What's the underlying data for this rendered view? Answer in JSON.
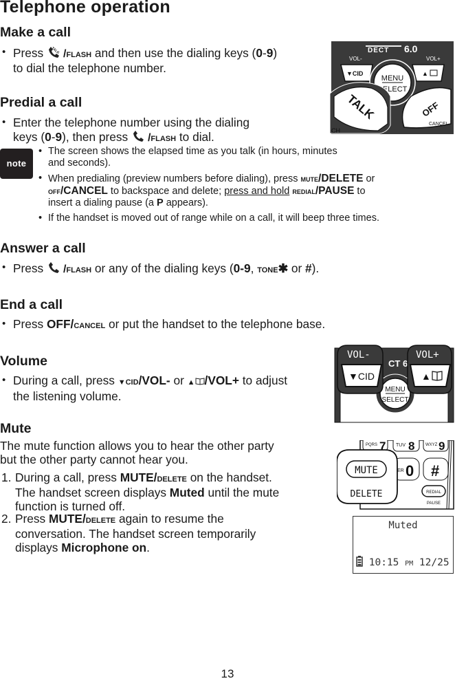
{
  "page": {
    "title": "Telephone operation",
    "page_number": "13"
  },
  "sections": {
    "make_call": {
      "heading": "Make a call",
      "b1_pre": "Press ",
      "b1_key": "/FLASH",
      "b1_mid": " and then use the dialing keys (",
      "b1_keys": "0",
      "b1_dash": "-",
      "b1_keys2": "9",
      "b1_post1": ")",
      "b1_line2": "to dial the telephone number."
    },
    "predial": {
      "heading": "Predial a call",
      "line1": "Enter the telephone number using the dialing",
      "l2_pre": "keys (",
      "l2_k1": "0",
      "l2_dash": "-",
      "l2_k2": "9",
      "l2_mid": "), then press ",
      "l2_key": "/FLASH",
      "l2_post": " to dial."
    },
    "note": {
      "label": "note",
      "items": [
        {
          "line1": "The screen shows the elapsed time as you talk (in hours, minutes",
          "line2": "and seconds)."
        },
        {
          "p1": "When predialing (preview numbers before dialing), press ",
          "k1": "MUTE",
          "k1b": "/DELETE",
          "p2": " or ",
          "k2": "OFF",
          "k2b": "/CANCEL",
          "p3": " to backspace and delete; ",
          "u": "press and hold",
          "p4": " ",
          "k3": "REDIAL",
          "k3b": "/PAUSE",
          "p5": " to",
          "p6": "insert a dialing pause (a ",
          "k4": "P",
          "p7": " appears)."
        },
        {
          "line1": "If the handset is moved out of range while on a call, it will beep three times."
        }
      ]
    },
    "answer": {
      "heading": "Answer a call",
      "pre": "Press ",
      "key": "/FLASH",
      "mid": " or any of the dialing keys (",
      "k1": "0-9",
      "comma": ", ",
      "tone": "TONE",
      "star": "✱",
      "or": " or ",
      "hash": "#",
      "post": ")."
    },
    "end": {
      "heading": "End a call",
      "pre": "Press ",
      "key": "OFF/",
      "key2": "CANCEL",
      "post": " or put the handset to the telephone base."
    },
    "volume": {
      "heading": "Volume",
      "pre": "During a call, press ",
      "k1a": "▼",
      "k1b": "CID",
      "k1c": "/VOL-",
      "or": " or ",
      "k2a": "▲",
      "k2b": "📖",
      "k2c": "/VOL+",
      "post": " to adjust",
      "line2": "the listening volume."
    },
    "mute": {
      "heading": "Mute",
      "intro1": "The mute function allows you to hear the other party",
      "intro2": "but the other party cannot hear you.",
      "steps": [
        {
          "n": "1.",
          "l1_pre": "During a call, press ",
          "l1_k": "MUTE/",
          "l1_k2": "DELETE",
          "l1_post": " on the handset.",
          "l2_pre": "The handset screen displays ",
          "l2_b": "Muted",
          "l2_post": " until the mute",
          "l3": "function is turned off."
        },
        {
          "n": "2.",
          "l1_pre": "Press ",
          "l1_k": "MUTE/",
          "l1_k2": "DELETE",
          "l1_post": " again to resume the",
          "l2": "conversation. The handset screen temporarily",
          "l3_pre": "displays ",
          "l3_b": "Microphone on",
          "l3_post": "."
        }
      ]
    }
  },
  "illustrations": {
    "handset_top": {
      "brand": "DECT",
      "brand_num": "6.0",
      "vol_minus": "VOL-",
      "vol_plus": "VOL+",
      "cid": "▼CID",
      "dir": "▲",
      "menu": "MENU",
      "select": "SELECT",
      "talk": "TALK",
      "off": "OFF",
      "cancel": "CANCEL",
      "ch": "CH"
    },
    "handset_vol": {
      "vol_minus": "VOL-",
      "vol_plus": "VOL+",
      "cid": "▼CID",
      "dir": "▲",
      "brand_frag": "CT 6",
      "menu": "MENU",
      "select": "SELECT"
    },
    "keypad": {
      "k7_letters": "PQRS",
      "k7": "7",
      "k8_letters": "TUV",
      "k8": "8",
      "k9_letters": "WXYZ",
      "k9": "9",
      "k0_frag": "ER",
      "k0": "0",
      "hash": "#",
      "mute": "MUTE",
      "delete": "DELETE",
      "redial": "REDIAL",
      "pause": "PAUSE"
    },
    "lcd": {
      "status": "Muted",
      "time": "10:15",
      "ampm": "PM",
      "date": "12/25"
    }
  }
}
